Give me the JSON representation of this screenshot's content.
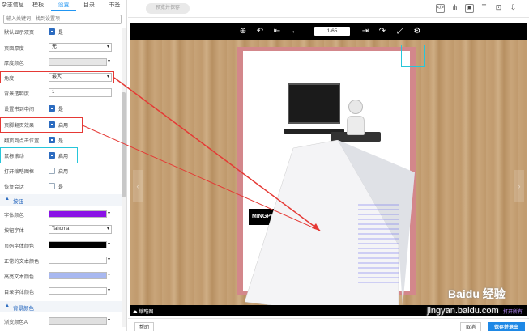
{
  "tabs": [
    "杂志信息",
    "模板",
    "设置",
    "目录",
    "书签"
  ],
  "search_placeholder": "输入关键词，找到设置项",
  "settings": [
    {
      "label": "默认显示双页",
      "type": "checkbox",
      "checked": true,
      "text": "是"
    },
    {
      "label": "页面厚度",
      "type": "select",
      "value": "无"
    },
    {
      "label": "厚度颜色",
      "type": "swatch",
      "color": "#e6e6e6"
    },
    {
      "label": "角度",
      "type": "select",
      "value": "最大"
    },
    {
      "label": "背景透明度",
      "type": "input",
      "value": "1"
    },
    {
      "label": "设置书到中间",
      "type": "checkbox",
      "checked": true,
      "text": "是"
    },
    {
      "label": "页脚翻页效果",
      "type": "checkbox",
      "checked": true,
      "text": "启用"
    },
    {
      "label": "翻页到点击位置",
      "type": "checkbox",
      "checked": true,
      "text": "是"
    },
    {
      "label": "鼠标滚动",
      "type": "checkbox",
      "checked": true,
      "text": "启用"
    },
    {
      "label": "打开缩略图框",
      "type": "checkbox",
      "checked": false,
      "text": "启用"
    },
    {
      "label": "恢复会话",
      "type": "checkbox",
      "checked": false,
      "text": "是"
    }
  ],
  "section_buttons": "按钮",
  "button_settings": [
    {
      "label": "字体颜色",
      "type": "swatch",
      "color": "#8a12e6"
    },
    {
      "label": "按钮字体",
      "type": "select",
      "value": "Tahoma"
    },
    {
      "label": "页码字体颜色",
      "type": "swatch",
      "color": "#000000"
    },
    {
      "label": "正常的文本颜色",
      "type": "swatch",
      "color": "#ffffff"
    },
    {
      "label": "高亮文本颜色",
      "type": "swatch",
      "color": "#a8b8f0"
    },
    {
      "label": "目录字体颜色",
      "type": "swatch",
      "color": "#ffffff"
    }
  ],
  "section_background": "背景颜色",
  "bg_settings": [
    {
      "label": "渐变颜色A",
      "type": "swatch",
      "color": "#e0e0e0"
    }
  ],
  "toolbar": {
    "preview": "预览并保存"
  },
  "viewer": {
    "page_indicator": "1/65",
    "bottom_left": "缩略图",
    "bottom_right": "打开所有",
    "page_brand": "MINGPIAO"
  },
  "watermark": {
    "line1": "Baidu 经验",
    "line2": "jingyan.baidu.com"
  },
  "actions": {
    "left": "帮助",
    "cancel": "取消",
    "publish": "保存并退出"
  }
}
